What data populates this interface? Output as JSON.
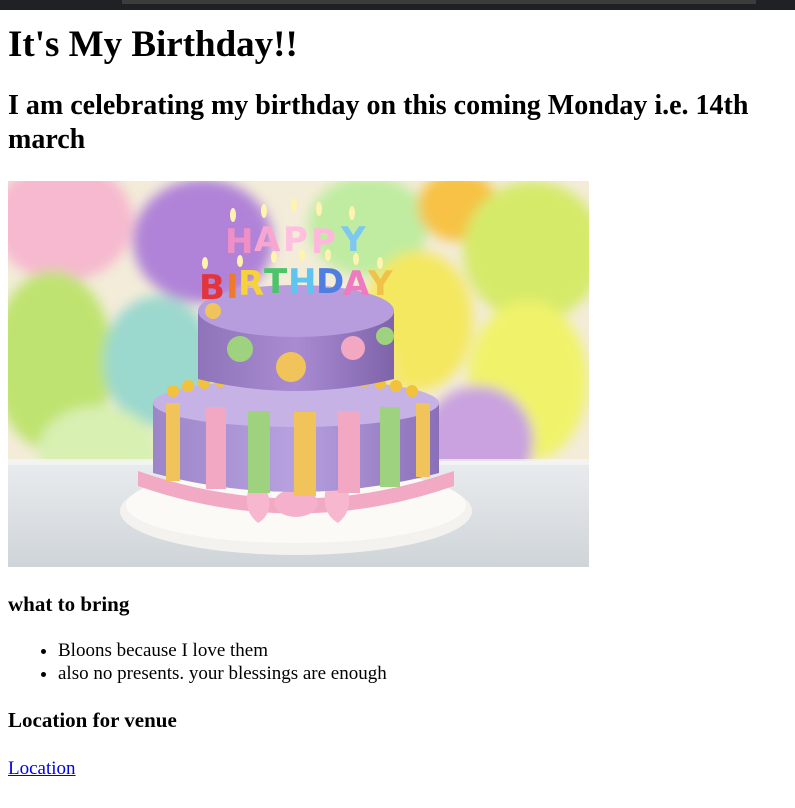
{
  "page": {
    "title": "It's My Birthday!!",
    "subtitle": "I am celebrating my birthday on this coming Monday i.e. 14th march",
    "image_name": "birthday-cake-image",
    "bring_heading": "what to bring",
    "bring_items": [
      "Bloons because I love them",
      "also no presents. your blessings are enough"
    ],
    "location_heading": "Location for venue",
    "location_link": "Location"
  },
  "cake": {
    "top_letters": "HAPPY",
    "bottom_letters": "BIRTHDAY"
  },
  "colors": {
    "link": "#0000ee",
    "topbar": "#202124"
  }
}
